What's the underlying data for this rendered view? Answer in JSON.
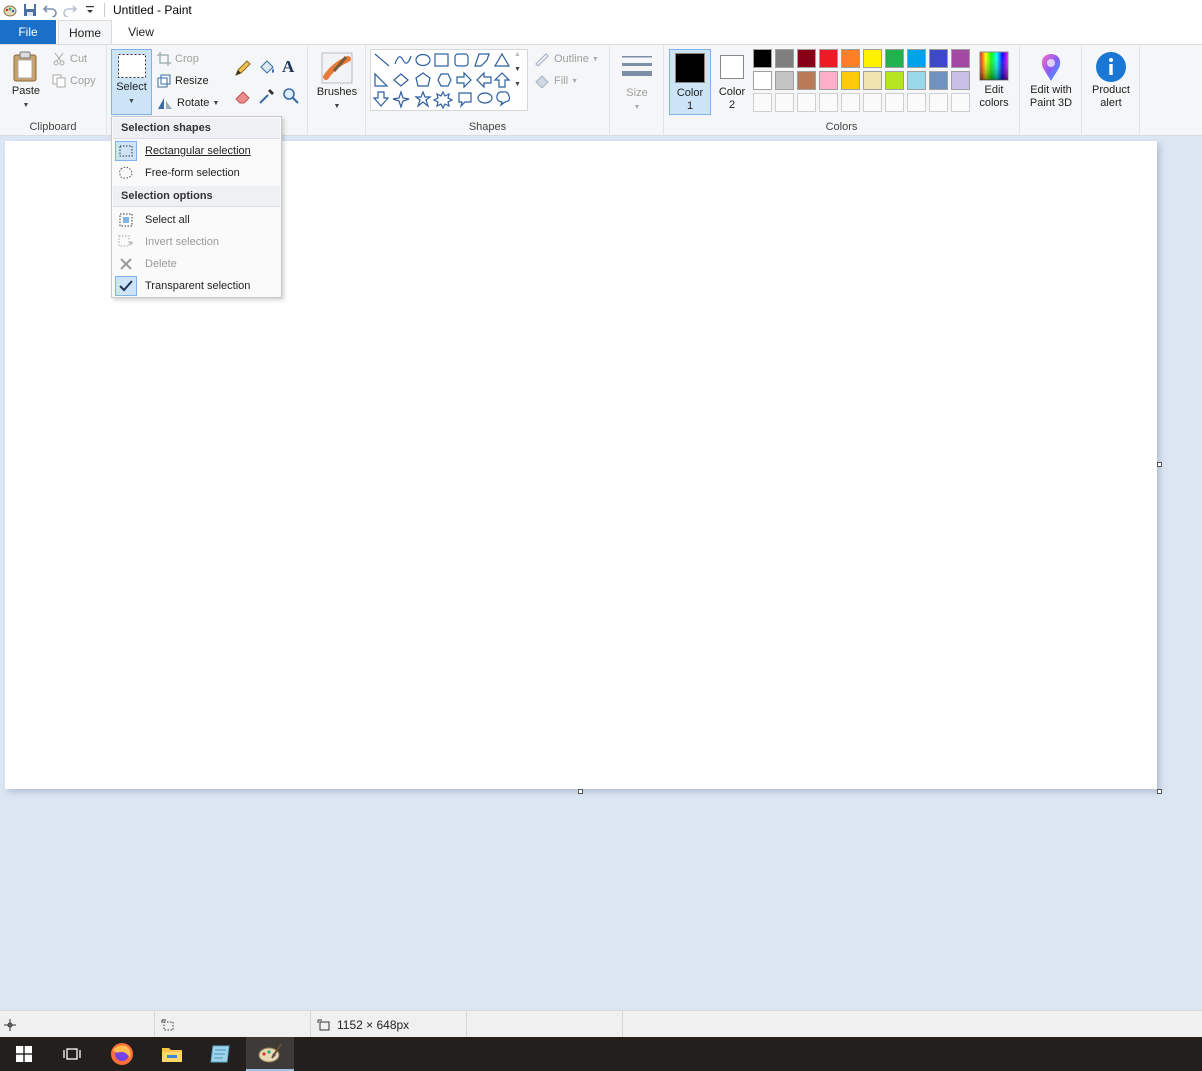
{
  "window": {
    "title": "Untitled - Paint"
  },
  "tabs": [
    {
      "label": "File"
    },
    {
      "label": "Home"
    },
    {
      "label": "View"
    }
  ],
  "ribbon": {
    "clipboard": {
      "group_label": "Clipboard",
      "paste_label": "Paste",
      "cut_label": "Cut",
      "copy_label": "Copy"
    },
    "image": {
      "select_label": "Select",
      "crop_label": "Crop",
      "resize_label": "Resize",
      "rotate_label": "Rotate"
    },
    "brushes_label": "Brushes",
    "shapes": {
      "group_label": "Shapes",
      "outline_label": "Outline",
      "fill_label": "Fill"
    },
    "size_label": "Size",
    "colors": {
      "group_label": "Colors",
      "color1_label": "Color 1",
      "color2_label": "Color 2",
      "color1_value": "#000000",
      "color2_value": "#ffffff",
      "edit_colors_label": "Edit colors",
      "palette_row1": [
        "#000000",
        "#7f7f7f",
        "#880015",
        "#ed1c24",
        "#ff7f27",
        "#fff200",
        "#22b14c",
        "#00a2e8",
        "#3f48cc",
        "#a349a4"
      ],
      "palette_row2": [
        "#ffffff",
        "#c3c3c3",
        "#b97a57",
        "#ffaec9",
        "#ffc90e",
        "#efe4b0",
        "#b5e61d",
        "#99d9ea",
        "#7092be",
        "#c8bfe7"
      ]
    },
    "paint3d_label": "Edit with Paint 3D",
    "product_alert_label": "Product alert"
  },
  "select_menu": {
    "shapes_header": "Selection shapes",
    "rectangular": "Rectangular selection",
    "freeform": "Free-form selection",
    "options_header": "Selection options",
    "select_all": "Select all",
    "invert": "Invert selection",
    "delete": "Delete",
    "transparent": "Transparent selection"
  },
  "statusbar": {
    "canvas_size": "1152 × 648px"
  }
}
